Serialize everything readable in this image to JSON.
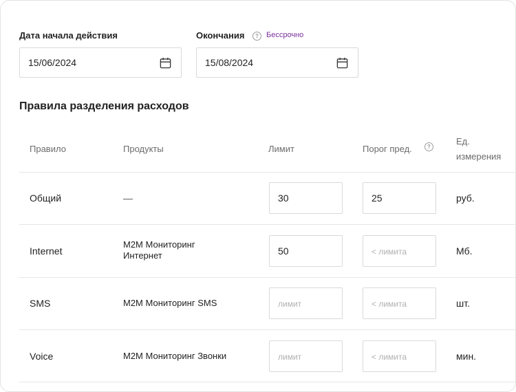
{
  "start_date": {
    "label": "Дата начала действия",
    "value": "15/06/2024"
  },
  "end_date": {
    "label": "Окончания",
    "link": "Бессрочно",
    "value": "15/08/2024"
  },
  "section_title": "Правила разделения расходов",
  "table": {
    "headers": {
      "rule": "Правило",
      "products": "Продукты",
      "limit": "Лимит",
      "threshold": "Порог пред.",
      "unit_line1": "Ед.",
      "unit_line2": "измерения"
    },
    "rows": [
      {
        "rule": "Общий",
        "products_line1": "—",
        "products_line2": "",
        "limit_value": "30",
        "limit_placeholder": "",
        "threshold_value": "25",
        "threshold_placeholder": "",
        "unit": "руб."
      },
      {
        "rule": "Internet",
        "products_line1": "M2M Мониторинг",
        "products_line2": "Интернет",
        "limit_value": "50",
        "limit_placeholder": "",
        "threshold_value": "",
        "threshold_placeholder": "< лимита",
        "unit": "Мб."
      },
      {
        "rule": "SMS",
        "products_line1": "M2M Мониторинг SMS",
        "products_line2": "",
        "limit_value": "",
        "limit_placeholder": "лимит",
        "threshold_value": "",
        "threshold_placeholder": "< лимита",
        "unit": "шт."
      },
      {
        "rule": "Voice",
        "products_line1": "M2M Мониторинг Звонки",
        "products_line2": "",
        "limit_value": "",
        "limit_placeholder": "лимит",
        "threshold_value": "",
        "threshold_placeholder": "< лимита",
        "unit": "мин."
      }
    ]
  },
  "icons": {
    "calendar": "calendar-icon",
    "help": "help-circle-icon"
  },
  "colors": {
    "link": "#7b2f9e",
    "border": "#d9d9d9",
    "header_text": "#6b6b6b"
  }
}
